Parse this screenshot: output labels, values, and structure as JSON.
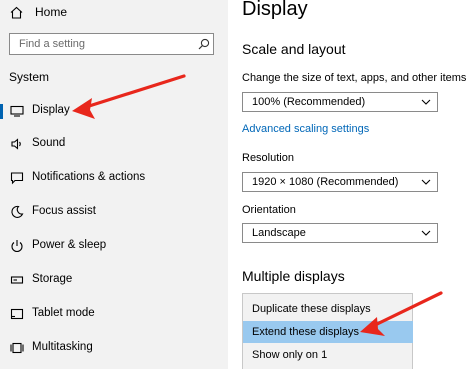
{
  "sidebar": {
    "home_label": "Home",
    "search_placeholder": "Find a setting",
    "section_title": "System",
    "items": [
      {
        "label": "Display",
        "icon": "monitor-icon",
        "selected": true
      },
      {
        "label": "Sound",
        "icon": "speaker-icon"
      },
      {
        "label": "Notifications & actions",
        "icon": "notification-icon"
      },
      {
        "label": "Focus assist",
        "icon": "moon-icon"
      },
      {
        "label": "Power & sleep",
        "icon": "power-icon"
      },
      {
        "label": "Storage",
        "icon": "storage-icon"
      },
      {
        "label": "Tablet mode",
        "icon": "tablet-icon"
      },
      {
        "label": "Multitasking",
        "icon": "multitasking-icon"
      }
    ]
  },
  "main": {
    "title": "Display",
    "scale_heading": "Scale and layout",
    "scale_label": "Change the size of text, apps, and other items",
    "scale_value": "100% (Recommended)",
    "advanced_link": "Advanced scaling settings",
    "resolution_label": "Resolution",
    "resolution_value": "1920 × 1080 (Recommended)",
    "orientation_label": "Orientation",
    "orientation_value": "Landscape",
    "multiple_heading": "Multiple displays",
    "multiple_options": [
      {
        "label": "Duplicate these displays"
      },
      {
        "label": "Extend these displays",
        "highlighted": true
      },
      {
        "label": "Show only on 1"
      }
    ]
  },
  "colors": {
    "sidebar_bg": "#f2f2f2",
    "accent_link": "#0067b8",
    "highlight": "#99c9ef",
    "annotation_arrow": "#e8271c"
  }
}
